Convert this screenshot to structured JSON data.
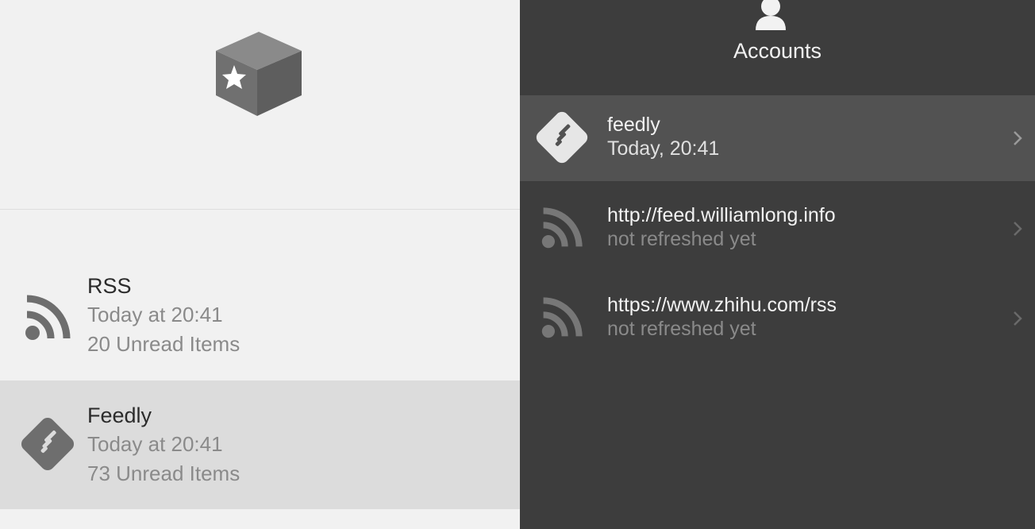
{
  "left_panel": {
    "sources": [
      {
        "title": "RSS",
        "updated": "Today at 20:41",
        "unread": "20 Unread Items",
        "icon": "rss-icon"
      },
      {
        "title": "Feedly",
        "updated": "Today at 20:41",
        "unread": "73 Unread Items",
        "icon": "feedly-icon"
      }
    ]
  },
  "right_panel": {
    "header": {
      "title": "Accounts",
      "icon": "user-icon"
    },
    "accounts": [
      {
        "name": "feedly",
        "status": "Today, 20:41",
        "icon": "feedly-icon",
        "selected": true
      },
      {
        "name": "http://feed.williamlong.info",
        "status": "not refreshed yet",
        "icon": "rss-icon",
        "selected": false
      },
      {
        "name": "https://www.zhihu.com/rss",
        "status": "not refreshed yet",
        "icon": "rss-icon",
        "selected": false
      }
    ]
  },
  "colors": {
    "left_bg": "#f1f1f1",
    "left_selected_bg": "#dcdcdc",
    "right_bg": "#3d3d3d",
    "right_selected_bg": "#525252",
    "icon_gray": "#6e6e6e"
  }
}
